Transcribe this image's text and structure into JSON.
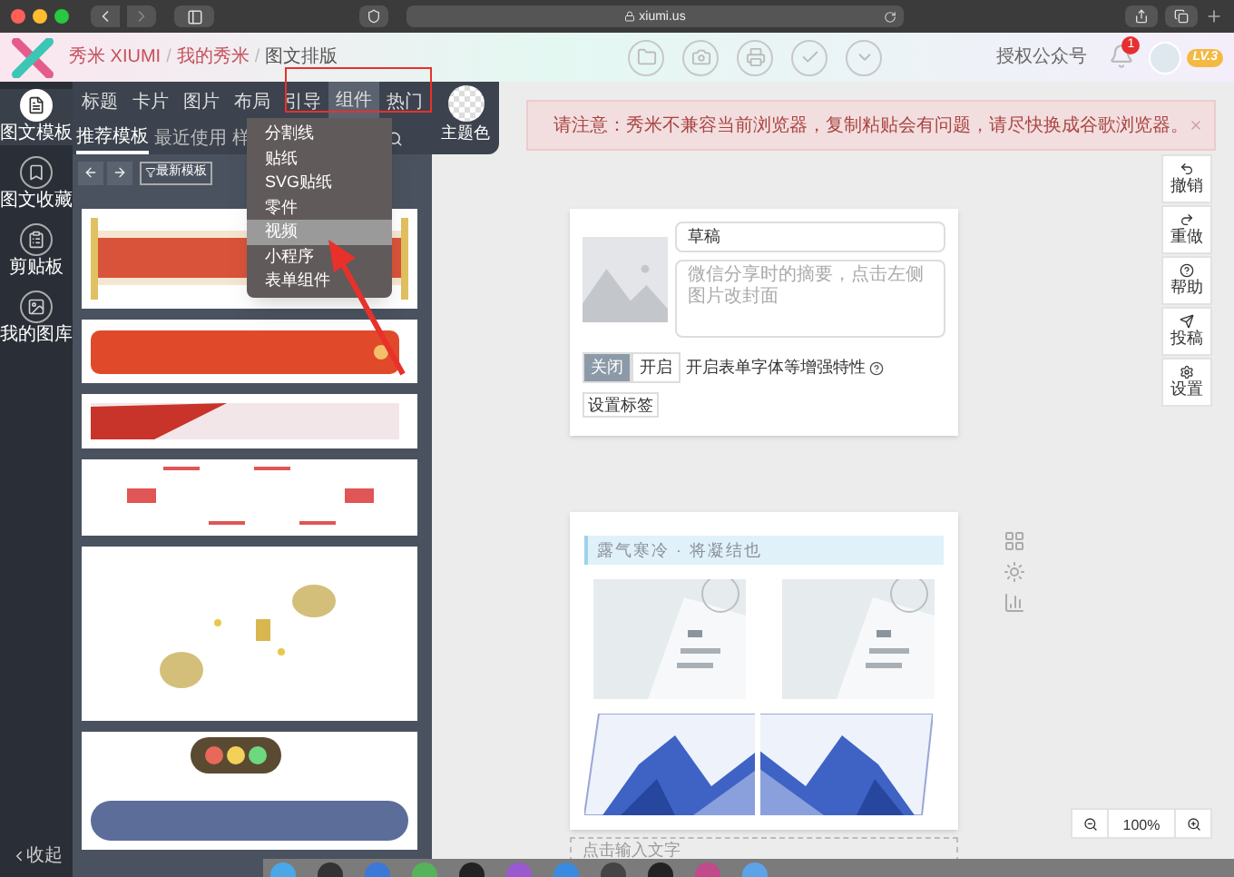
{
  "browser": {
    "url": "xiumi.us"
  },
  "header": {
    "breadcrumb": [
      "秀米 XIUMI",
      "我的秀米",
      "图文排版"
    ],
    "separator": "/",
    "authorize": "授权公众号",
    "notification_count": "1",
    "level": "LV.3"
  },
  "sidebar": {
    "items": [
      {
        "label": "图文模板",
        "selected": true
      },
      {
        "label": "图文收藏",
        "selected": false
      },
      {
        "label": "剪贴板",
        "selected": false
      },
      {
        "label": "我的图库",
        "selected": false
      }
    ],
    "collapse": "收起"
  },
  "category_tabs": [
    {
      "label": "标题",
      "selected": false
    },
    {
      "label": "卡片",
      "selected": false
    },
    {
      "label": "图片",
      "selected": false
    },
    {
      "label": "布局",
      "selected": false
    },
    {
      "label": "引导",
      "selected": false
    },
    {
      "label": "组件",
      "selected": true
    },
    {
      "label": "热门",
      "selected": false
    }
  ],
  "sub_tabs": [
    {
      "label": "推荐模板",
      "selected": true
    },
    {
      "label": "最近使用",
      "selected": false
    },
    {
      "label": "样",
      "selected": false
    }
  ],
  "theme_color": {
    "label": "主题色"
  },
  "toolbar": {
    "latest": "最新模板"
  },
  "dropdown": [
    {
      "label": "分割线",
      "selected": false
    },
    {
      "label": "贴纸",
      "selected": false
    },
    {
      "label": "SVG贴纸",
      "selected": false
    },
    {
      "label": "零件",
      "selected": false
    },
    {
      "label": "视频",
      "selected": true
    },
    {
      "label": "小程序",
      "selected": false
    },
    {
      "label": "表单组件",
      "selected": false
    }
  ],
  "warning": "请注意：秀米不兼容当前浏览器，复制粘贴会有问题，请尽快换成谷歌浏览器。",
  "right_tools": [
    {
      "label": "撤销",
      "kind": "undo"
    },
    {
      "label": "重做",
      "kind": "redo"
    },
    {
      "label": "帮助",
      "kind": "help"
    },
    {
      "label": "投稿",
      "kind": "submit"
    },
    {
      "label": "设置",
      "kind": "settings"
    }
  ],
  "cover_card": {
    "title": "草稿",
    "summary_placeholder": "微信分享时的摘要，点击左侧图片改封面",
    "toggle": [
      {
        "label": "关闭",
        "selected": true
      },
      {
        "label": "开启",
        "selected": false
      }
    ],
    "toggle_note": "开启表单字体等增强特性",
    "tag_button": "设置标签"
  },
  "article": {
    "heading": "露气寒冷 · 将凝结也",
    "input_placeholder": "点击输入文字"
  },
  "zoom": {
    "value": "100%"
  }
}
